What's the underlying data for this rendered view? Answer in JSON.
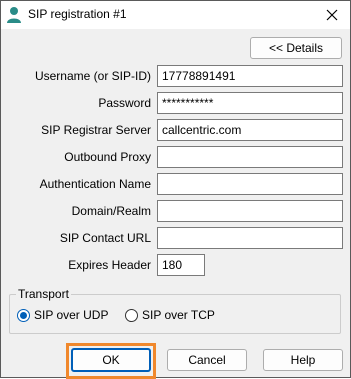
{
  "window": {
    "title": "SIP registration #1"
  },
  "details_button": "<< Details",
  "fields": [
    {
      "label": "Username (or SIP-ID)",
      "value": "17778891491"
    },
    {
      "label": "Password",
      "value": "***********"
    },
    {
      "label": "SIP Registrar Server",
      "value": "callcentric.com"
    },
    {
      "label": "Outbound Proxy",
      "value": ""
    },
    {
      "label": "Authentication Name",
      "value": ""
    },
    {
      "label": "Domain/Realm",
      "value": ""
    },
    {
      "label": "SIP Contact URL",
      "value": ""
    },
    {
      "label": "Expires Header",
      "value": "180"
    }
  ],
  "transport": {
    "title": "Transport",
    "options": [
      {
        "label": "SIP over UDP",
        "checked": true
      },
      {
        "label": "SIP over TCP",
        "checked": false
      }
    ]
  },
  "buttons": {
    "ok": "OK",
    "cancel": "Cancel",
    "help": "Help"
  },
  "colors": {
    "accent": "#005fb8",
    "highlight": "#f0882c",
    "dialog_bg": "#f0f0f0"
  },
  "icons": {
    "app": "user-icon",
    "close": "close-icon"
  }
}
